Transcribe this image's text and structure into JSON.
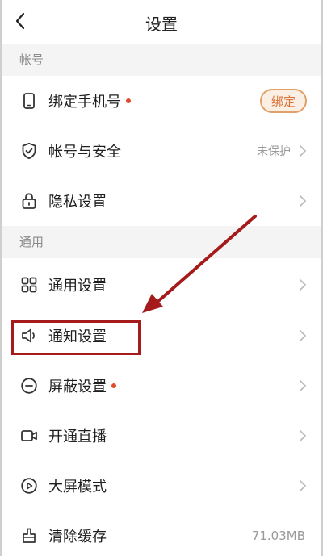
{
  "header": {
    "title": "设置"
  },
  "sections": {
    "account": "帐号",
    "general": "通用"
  },
  "rows": {
    "bind_phone": {
      "label": "绑定手机号",
      "button": "绑定"
    },
    "account_security": {
      "label": "帐号与安全",
      "status": "未保护"
    },
    "privacy": {
      "label": "隐私设置"
    },
    "general_settings": {
      "label": "通用设置"
    },
    "notification": {
      "label": "通知设置"
    },
    "block": {
      "label": "屏蔽设置"
    },
    "live": {
      "label": "开通直播"
    },
    "bigscreen": {
      "label": "大屏模式"
    },
    "clear_cache": {
      "label": "清除缓存",
      "value": "71.03MB"
    }
  },
  "colors": {
    "accent": "#d9733a",
    "dot": "#e04a2a",
    "annotation": "#a51b1b"
  },
  "icons": [
    "back-arrow-icon",
    "phone-icon",
    "shield-check-icon",
    "lock-icon",
    "grid-icon",
    "speaker-icon",
    "minus-circle-icon",
    "video-camera-icon",
    "play-circle-icon",
    "broom-icon",
    "chevron-right-icon"
  ]
}
